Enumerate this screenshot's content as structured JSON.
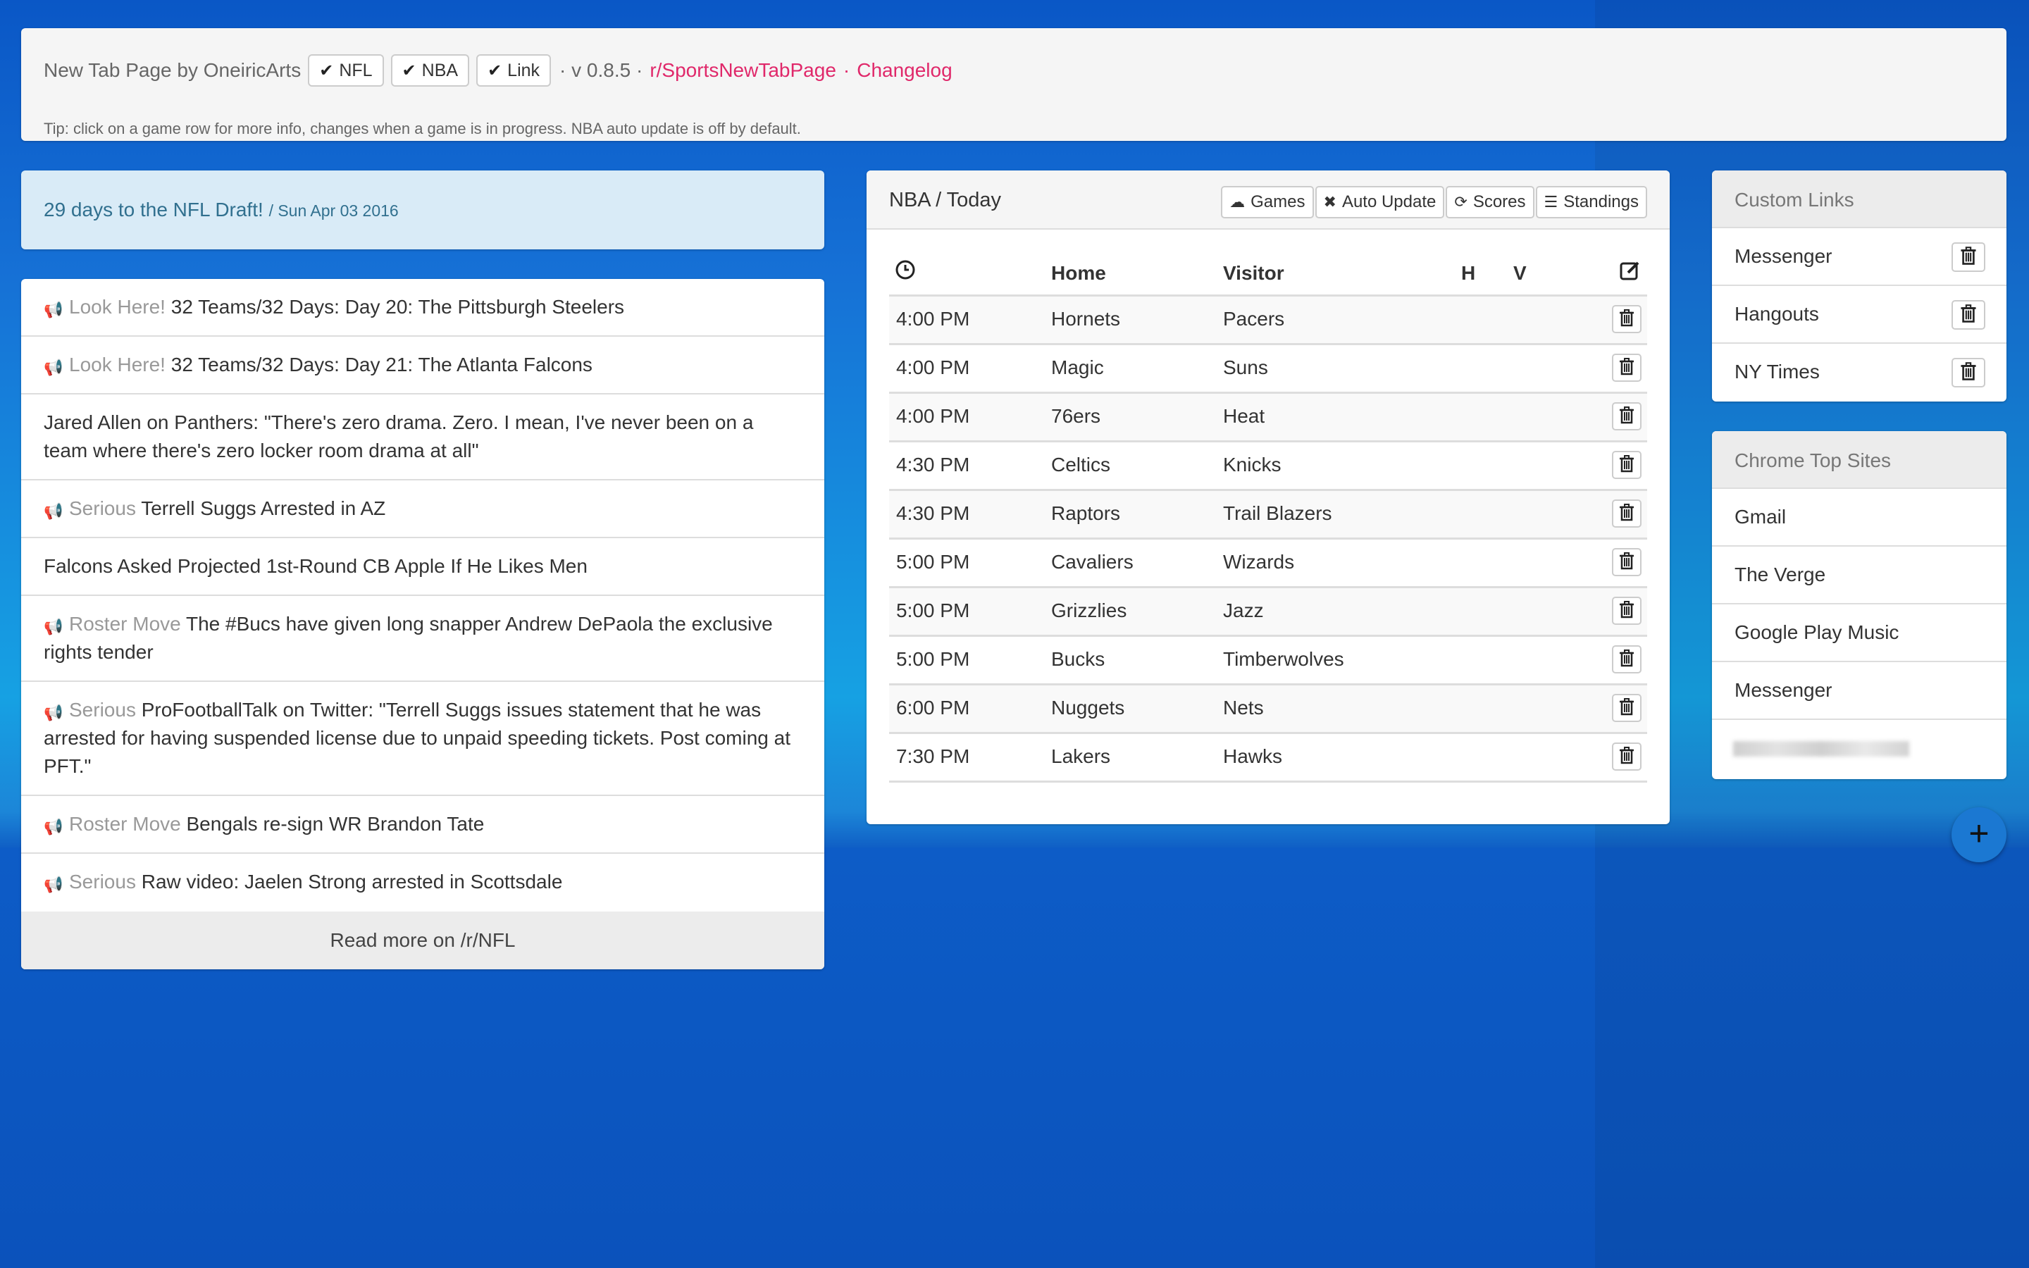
{
  "header": {
    "title": "New Tab Page by OneiricArts",
    "chips": [
      "NFL",
      "NBA",
      "Link"
    ],
    "version": "· v 0.8.5 ·",
    "subreddit_link": "r/SportsNewTabPage",
    "separator": "·",
    "changelog_link": "Changelog",
    "tip": "Tip: click on a game row for more info, changes when a game is in progress. NBA auto update is off by default."
  },
  "draft": {
    "text": "29 days to the NFL Draft!",
    "date": "/ Sun Apr 03 2016"
  },
  "news": {
    "items": [
      {
        "tag": "Look Here!",
        "text": "32 Teams/32 Days: Day 20: The Pittsburgh Steelers"
      },
      {
        "tag": "Look Here!",
        "text": "32 Teams/32 Days: Day 21: The Atlanta Falcons"
      },
      {
        "tag": "",
        "text": "Jared Allen on Panthers: \"There's zero drama. Zero. I mean, I've never been on a team where there's zero locker room drama at all\""
      },
      {
        "tag": "Serious",
        "text": "Terrell Suggs Arrested in AZ"
      },
      {
        "tag": "",
        "text": "Falcons Asked Projected 1st-Round CB Apple If He Likes Men"
      },
      {
        "tag": "Roster Move",
        "text": "The #Bucs have given long snapper Andrew DePaola the exclusive rights tender"
      },
      {
        "tag": "Serious",
        "text": "ProFootballTalk on Twitter: \"Terrell Suggs issues statement that he was arrested for having suspended license due to unpaid speeding tickets. Post coming at PFT.\""
      },
      {
        "tag": "Roster Move",
        "text": "Bengals re-sign WR Brandon Tate"
      },
      {
        "tag": "Serious",
        "text": "Raw video: Jaelen Strong arrested in Scottsdale"
      }
    ],
    "read_more": "Read more on /r/NFL"
  },
  "nba": {
    "title": "NBA / Today",
    "buttons": {
      "games": "Games",
      "auto_update": "Auto Update",
      "scores": "Scores",
      "standings": "Standings"
    },
    "columns": {
      "home": "Home",
      "visitor": "Visitor",
      "h": "H",
      "v": "V"
    },
    "games": [
      {
        "time": "4:00 PM",
        "home": "Hornets",
        "visitor": "Pacers"
      },
      {
        "time": "4:00 PM",
        "home": "Magic",
        "visitor": "Suns"
      },
      {
        "time": "4:00 PM",
        "home": "76ers",
        "visitor": "Heat"
      },
      {
        "time": "4:30 PM",
        "home": "Celtics",
        "visitor": "Knicks"
      },
      {
        "time": "4:30 PM",
        "home": "Raptors",
        "visitor": "Trail Blazers"
      },
      {
        "time": "5:00 PM",
        "home": "Cavaliers",
        "visitor": "Wizards"
      },
      {
        "time": "5:00 PM",
        "home": "Grizzlies",
        "visitor": "Jazz"
      },
      {
        "time": "5:00 PM",
        "home": "Bucks",
        "visitor": "Timberwolves"
      },
      {
        "time": "6:00 PM",
        "home": "Nuggets",
        "visitor": "Nets"
      },
      {
        "time": "7:30 PM",
        "home": "Lakers",
        "visitor": "Hawks"
      }
    ]
  },
  "custom_links": {
    "title": "Custom Links",
    "items": [
      "Messenger",
      "Hangouts",
      "NY Times"
    ]
  },
  "top_sites": {
    "title": "Chrome Top Sites",
    "items": [
      "Gmail",
      "The Verge",
      "Google Play Music",
      "Messenger"
    ]
  },
  "fab": {
    "label": "+"
  }
}
